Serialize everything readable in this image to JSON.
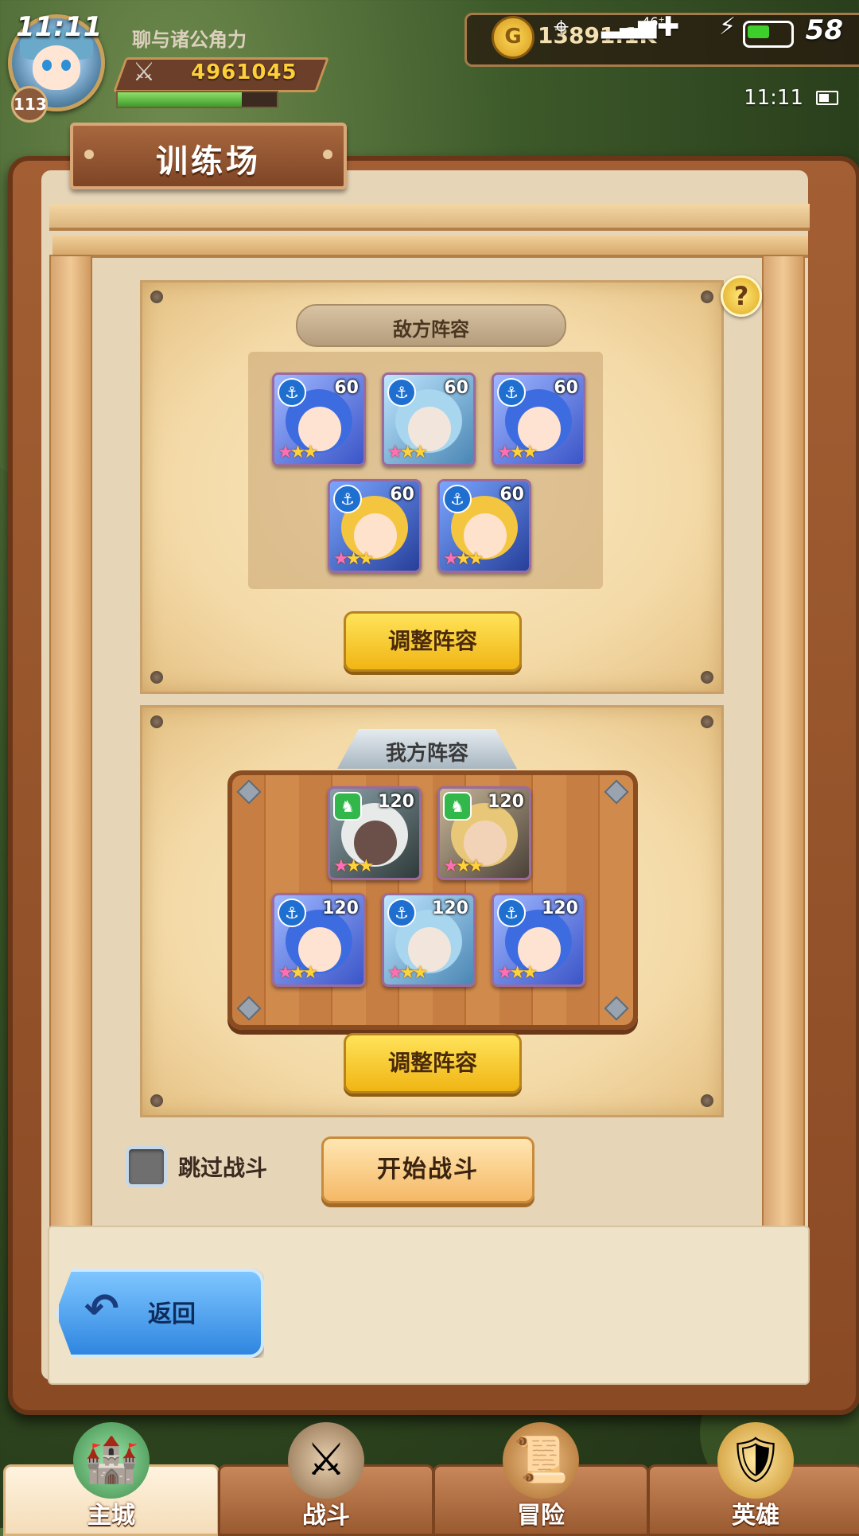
{
  "status_bar": {
    "time": "11:11",
    "clock": "11:11",
    "battery_level": "58",
    "network": "46⁺"
  },
  "player": {
    "level": "113",
    "name": "聊与诸公角力",
    "power": "4961045",
    "xp_fraction": 0.78,
    "gold": "13891.1K"
  },
  "page": {
    "title": "训练场"
  },
  "enemy": {
    "label": "敌方阵容",
    "adjust_label": "调整阵容",
    "heroes": [
      {
        "level": "60",
        "class": "anchor",
        "portrait": "blue-hair-witch"
      },
      {
        "level": "60",
        "class": "anchor",
        "portrait": "blindfold-silver-hair"
      },
      {
        "level": "60",
        "class": "anchor",
        "portrait": "blue-hair-witch"
      },
      {
        "level": "60",
        "class": "anchor",
        "portrait": "blonde-girl"
      },
      {
        "level": "60",
        "class": "anchor",
        "portrait": "blonde-girl"
      }
    ]
  },
  "ally": {
    "label": "我方阵容",
    "adjust_label": "调整阵容",
    "heroes": [
      {
        "level": "120",
        "class": "beast",
        "portrait": "dark-elf-white-hair"
      },
      {
        "level": "120",
        "class": "beast",
        "portrait": "blonde-warrior"
      },
      {
        "level": "120",
        "class": "anchor",
        "portrait": "blue-hair-witch"
      },
      {
        "level": "120",
        "class": "anchor",
        "portrait": "blindfold-silver-hair"
      },
      {
        "level": "120",
        "class": "anchor",
        "portrait": "blue-hair-witch"
      }
    ]
  },
  "controls": {
    "skip_battle_label": "跳过战斗",
    "skip_battle_checked": false,
    "start_battle_label": "开始战斗",
    "back_label": "返回"
  },
  "nav": {
    "tabs": [
      {
        "label": "主城",
        "icon": "castle-portal-icon",
        "active": true
      },
      {
        "label": "战斗",
        "icon": "crossed-swords-icon",
        "active": false
      },
      {
        "label": "冒险",
        "icon": "scroll-map-icon",
        "active": false
      },
      {
        "label": "英雄",
        "icon": "hero-crest-icon",
        "active": false
      }
    ]
  },
  "colors": {
    "accent_yellow": "#f0b514",
    "back_blue": "#2f86e0",
    "wood_brown": "#8a4a24"
  }
}
